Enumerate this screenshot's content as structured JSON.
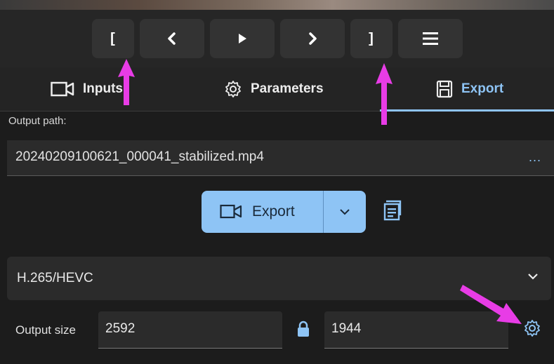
{
  "controls": {
    "set_start_label": "[",
    "set_end_label": "]",
    "icons": [
      "chevron-left-icon",
      "play-icon",
      "chevron-right-icon",
      "menu-icon"
    ]
  },
  "tabs": [
    {
      "label": "Inputs",
      "icon": "video-camera-icon"
    },
    {
      "label": "Parameters",
      "icon": "gear-icon"
    },
    {
      "label": "Export",
      "icon": "save-icon",
      "active": true
    }
  ],
  "export": {
    "output_path_label": "Output path:",
    "output_path_value": "20240209100621_000041_stabilized.mp4",
    "browse_label": "...",
    "export_button_label": "Export",
    "codec_value": "H.265/HEVC",
    "output_size_label": "Output size",
    "width": "2592",
    "height": "1944"
  },
  "colors": {
    "accent": "#8ec4f5",
    "background": "#1c1c1c",
    "annotation": "#e83ce6"
  }
}
